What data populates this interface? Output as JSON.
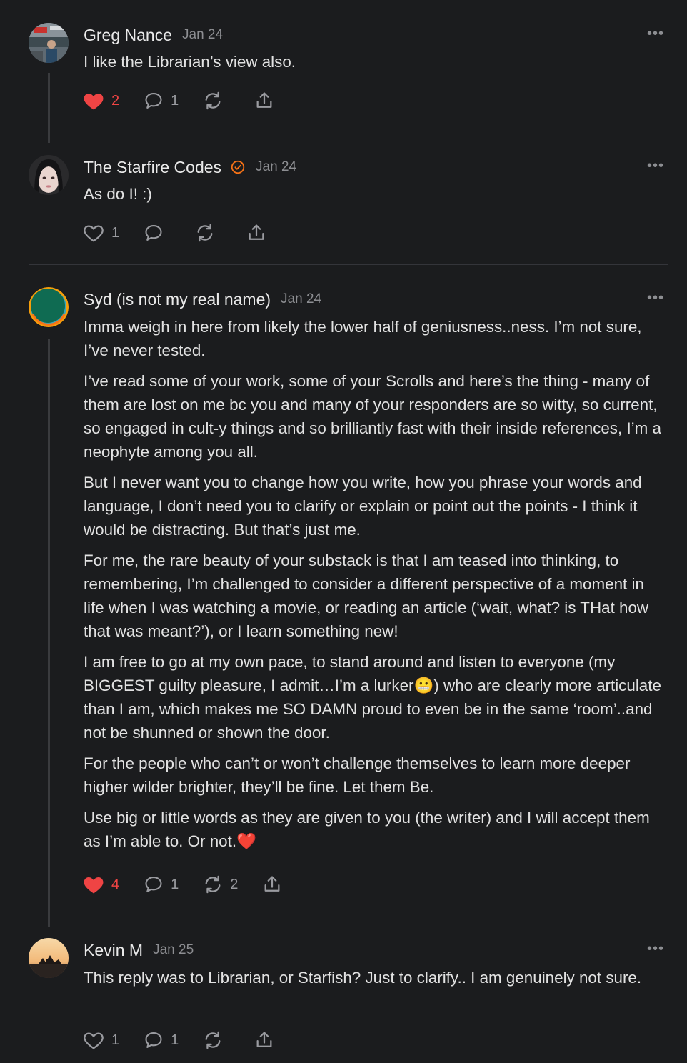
{
  "comments": [
    {
      "name": "Greg Nance",
      "date": "Jan 24",
      "more": "•••",
      "paragraphs": [
        "I like the Librarian’s view also."
      ],
      "likes": "2",
      "replies": "1",
      "restacks": "",
      "liked": true
    },
    {
      "name": "The Starfire Codes",
      "date": "Jan 24",
      "more": "•••",
      "paragraphs": [
        "As do I! :)"
      ],
      "likes": "1",
      "replies": "",
      "restacks": "",
      "liked": false
    },
    {
      "name": "Syd (is not my real name)",
      "date": "Jan 24",
      "more": "•••",
      "paragraphs": [
        "Imma weigh in here from likely the lower half of geniusness..ness. I’m not sure, I’ve never tested.",
        "I’ve read some of your work, some of your Scrolls and here’s the thing - many of them are lost on me bc you and many of your responders are so witty, so current, so engaged in cult-y things and so brilliantly fast with their inside references, I’m a neophyte among you all.",
        "But I never want you to change how you write, how you phrase your words and language, I don’t need you to clarify or explain or point out the points - I think it would be distracting. But that’s just me.",
        "For me, the rare beauty of your substack is that I am teased into thinking, to remembering, I’m challenged to consider a different perspective of a moment in life when I was watching a movie, or reading an article (‘wait, what? is THat how that was meant?’), or I learn something new!",
        "I am free to go at my own pace, to stand around and listen to everyone (my BIGGEST guilty pleasure, I admit…I’m a lurker😬) who are clearly more articulate than I am, which makes me SO DAMN proud to even be in the same ‘room’..and not be shunned or shown the door.",
        "For the people who can’t or won’t challenge themselves to learn more deeper higher wilder brighter, they’ll be fine. Let them Be.",
        "Use big or little words as they are given to you (the writer) and I will accept them as I’m able to. Or not.❤️"
      ],
      "likes": "4",
      "replies": "1",
      "restacks": "2",
      "liked": true
    },
    {
      "name": "Kevin M",
      "date": "Jan 25",
      "more": "•••",
      "paragraphs": [
        "This reply was to Librarian, or Starfish? Just to clarify.. I am genuinely not sure."
      ],
      "likes": "1",
      "replies": "1",
      "restacks": "",
      "liked": false
    }
  ],
  "colors": {
    "like": "#ef4444",
    "muted": "#9a9ba0",
    "badge": "#f97316",
    "background": "#1b1c1e"
  },
  "icons": [
    "heart-icon",
    "comment-icon",
    "restack-icon",
    "share-icon",
    "verified-badge-icon",
    "more-icon"
  ]
}
